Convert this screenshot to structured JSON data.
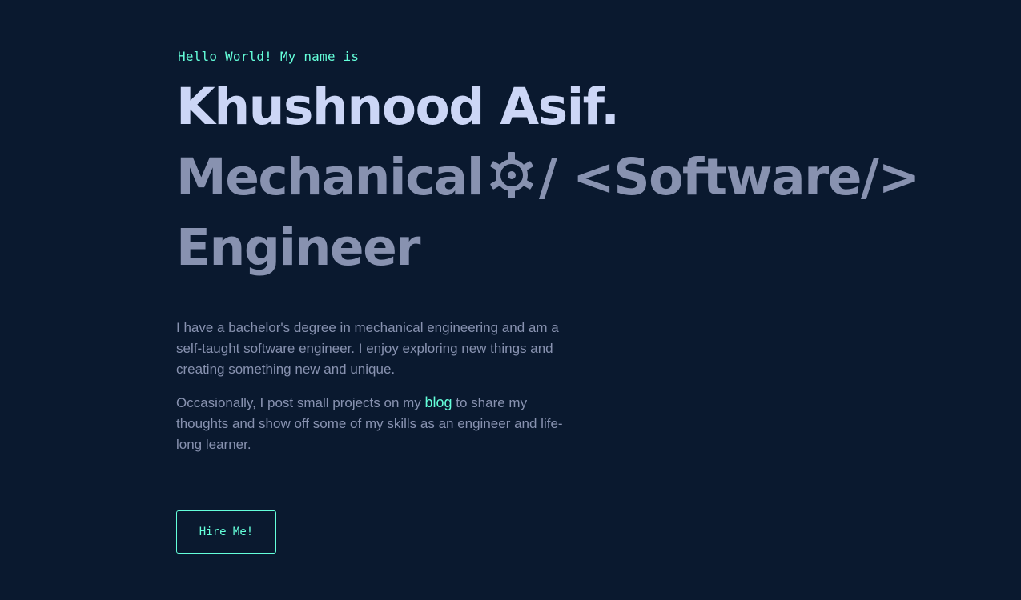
{
  "hero": {
    "greeting": "Hello World! My name is",
    "name": "Khushnood Asif.",
    "role_part1": "Mechanical",
    "role_icon": "gear-icon",
    "role_part2": "/ <Software/>",
    "role_line2": "Engineer"
  },
  "bio": {
    "paragraph1": "I have a bachelor's degree in mechanical engineering and am a self-taught software engineer. I enjoy exploring new things and creating something new and unique.",
    "paragraph2_before": "Occasionally, I post small projects on my ",
    "paragraph2_link": "blog",
    "paragraph2_after": " to share my thoughts and show off some of my skills as an engineer and life-long learner."
  },
  "cta": {
    "hire_label": "Hire Me!"
  },
  "colors": {
    "background": "#0a192f",
    "accent": "#64ffda",
    "heading": "#ccd6f6",
    "muted": "#8892b0"
  }
}
